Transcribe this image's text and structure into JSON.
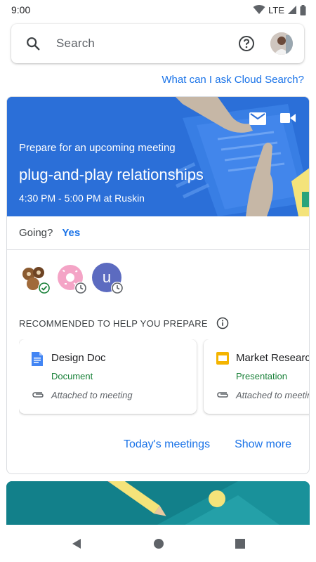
{
  "status": {
    "time": "9:00",
    "network": "LTE"
  },
  "search": {
    "placeholder": "Search"
  },
  "ask_link": "What can I ask Cloud Search?",
  "meeting": {
    "prompt": "Prepare for an upcoming meeting",
    "title": "plug-and-play relationships",
    "time_location": "4:30 PM - 5:00 PM at Ruskin",
    "going_label": "Going?",
    "going_value": "Yes",
    "attendees": [
      {
        "initial": "",
        "status": "accepted"
      },
      {
        "initial": "",
        "status": "pending"
      },
      {
        "initial": "u",
        "status": "pending"
      }
    ]
  },
  "recommended": {
    "header": "RECOMMENDED TO HELP YOU PREPARE",
    "docs": [
      {
        "name": "Design Doc",
        "type": "Document",
        "attachment": "Attached to meeting",
        "icon": "google-docs-icon"
      },
      {
        "name": "Market Research",
        "type": "Presentation",
        "attachment": "Attached to meeting",
        "icon": "google-slides-icon"
      }
    ]
  },
  "actions": {
    "todays_meetings": "Today's meetings",
    "show_more": "Show more"
  },
  "colors": {
    "accent": "#1a73e8",
    "hero": "#2b6fd8",
    "doc_green": "#188038",
    "second_card": "#12808a"
  }
}
